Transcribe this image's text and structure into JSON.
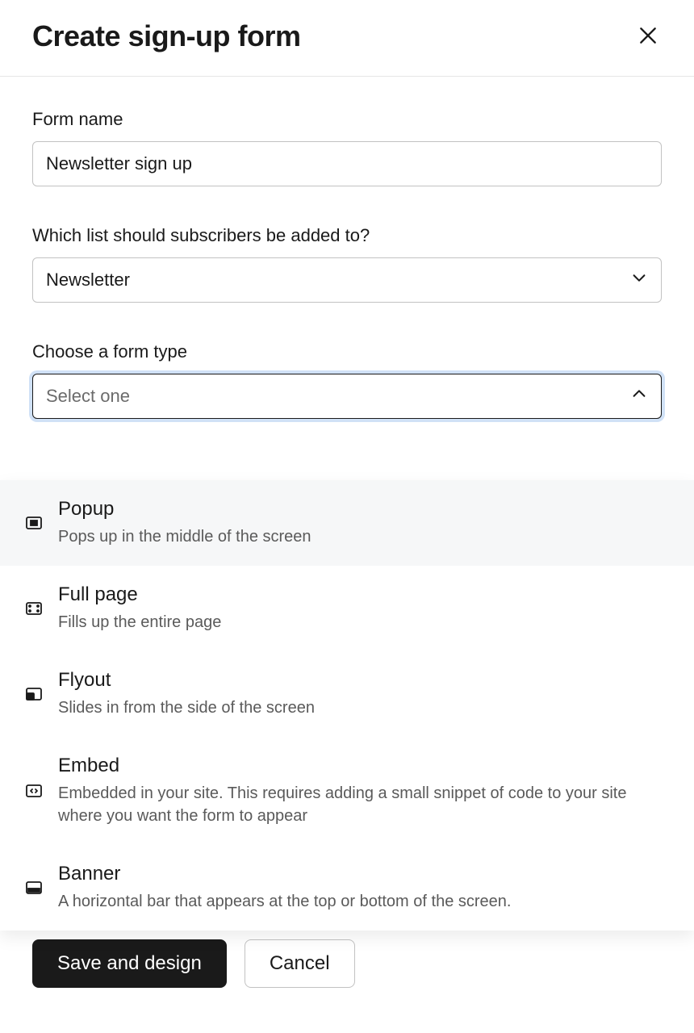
{
  "header": {
    "title": "Create sign-up form"
  },
  "form_name": {
    "label": "Form name",
    "value": "Newsletter sign up"
  },
  "list_select": {
    "label": "Which list should subscribers be added to?",
    "selected": "Newsletter"
  },
  "form_type": {
    "label": "Choose a form type",
    "placeholder": "Select one",
    "options": [
      {
        "icon": "popup-icon",
        "title": "Popup",
        "desc": "Pops up in the middle of the screen"
      },
      {
        "icon": "fullpage-icon",
        "title": "Full page",
        "desc": "Fills up the entire page"
      },
      {
        "icon": "flyout-icon",
        "title": "Flyout",
        "desc": "Slides in from the side of the screen"
      },
      {
        "icon": "embed-icon",
        "title": "Embed",
        "desc": "Embedded in your site. This requires adding a small snippet of code to your site where you want the form to appear"
      },
      {
        "icon": "banner-icon",
        "title": "Banner",
        "desc": "A horizontal bar that appears at the top or bottom of the screen."
      }
    ]
  },
  "footer": {
    "primary": "Save and design",
    "secondary": "Cancel"
  }
}
